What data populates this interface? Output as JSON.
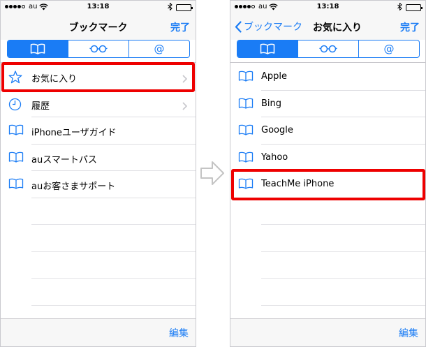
{
  "status": {
    "carrier": "au",
    "time": "13:18"
  },
  "left_screen": {
    "nav_title": "ブックマーク",
    "done_label": "完了",
    "segments": [
      {
        "icon": "bookmarks-book-icon",
        "active": true
      },
      {
        "icon": "reading-list-glasses-icon",
        "active": false
      },
      {
        "icon": "shared-links-at-icon",
        "label": "@",
        "active": false
      }
    ],
    "rows": [
      {
        "icon": "star-icon",
        "label": "お気に入り",
        "chevron": true
      },
      {
        "icon": "clock-icon",
        "label": "履歴",
        "chevron": true
      },
      {
        "icon": "book-icon",
        "label": "iPhoneユーザガイド",
        "chevron": false
      },
      {
        "icon": "book-icon",
        "label": "auスマートパス",
        "chevron": false
      },
      {
        "icon": "book-icon",
        "label": "auお客さまサポート",
        "chevron": false
      }
    ],
    "edit_label": "編集"
  },
  "right_screen": {
    "back_label": "ブックマーク",
    "nav_title": "お気に入り",
    "done_label": "完了",
    "segments": [
      {
        "icon": "bookmarks-book-icon",
        "active": true
      },
      {
        "icon": "reading-list-glasses-icon",
        "active": false
      },
      {
        "icon": "shared-links-at-icon",
        "label": "@",
        "active": false
      }
    ],
    "rows": [
      {
        "icon": "book-icon",
        "label": "Apple"
      },
      {
        "icon": "book-icon",
        "label": "Bing"
      },
      {
        "icon": "book-icon",
        "label": "Google"
      },
      {
        "icon": "book-icon",
        "label": "Yahoo"
      },
      {
        "icon": "book-icon",
        "label": "TeachMe iPhone"
      }
    ],
    "edit_label": "編集"
  },
  "colors": {
    "accent": "#1a7cf5",
    "highlight": "#ee0000",
    "bar": "#f7f7f7"
  },
  "battery_level": 1.0
}
